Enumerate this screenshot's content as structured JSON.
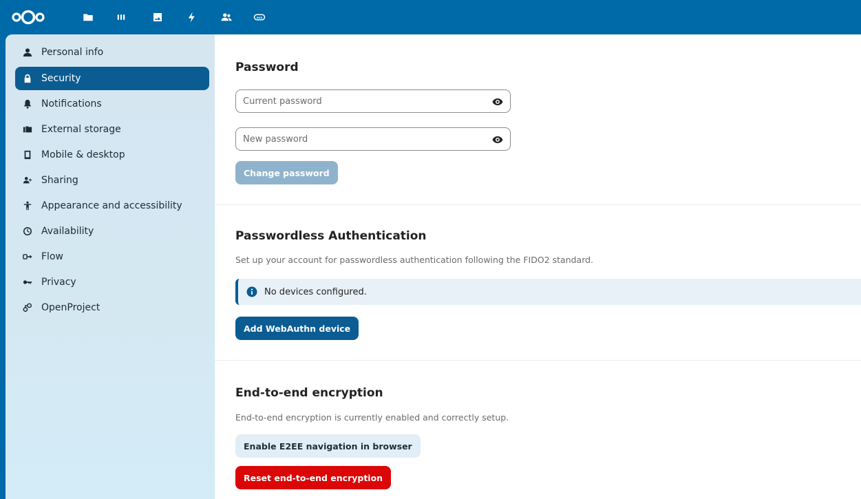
{
  "header": {
    "apps": [
      {
        "icon": "folder-icon",
        "name": "files"
      },
      {
        "icon": "deck-icon",
        "name": "deck"
      },
      {
        "icon": "photos-icon",
        "name": "photos"
      },
      {
        "icon": "activity-icon",
        "name": "activity"
      },
      {
        "icon": "contacts-icon",
        "name": "contacts"
      },
      {
        "icon": "ocs-icon",
        "name": "ocs"
      }
    ]
  },
  "sidebar": {
    "items": [
      {
        "label": "Personal info",
        "icon": "user-icon"
      },
      {
        "label": "Security",
        "icon": "lock-icon",
        "active": true
      },
      {
        "label": "Notifications",
        "icon": "bell-icon"
      },
      {
        "label": "External storage",
        "icon": "external-storage-icon"
      },
      {
        "label": "Mobile & desktop",
        "icon": "phone-icon"
      },
      {
        "label": "Sharing",
        "icon": "share-user-icon"
      },
      {
        "label": "Appearance and accessibility",
        "icon": "accessibility-icon"
      },
      {
        "label": "Availability",
        "icon": "clock-icon"
      },
      {
        "label": "Flow",
        "icon": "flow-icon"
      },
      {
        "label": "Privacy",
        "icon": "key-icon"
      },
      {
        "label": "OpenProject",
        "icon": "openproject-icon"
      }
    ]
  },
  "password": {
    "title": "Password",
    "current_placeholder": "Current password",
    "new_placeholder": "New password",
    "change_label": "Change password"
  },
  "passwordless": {
    "title": "Passwordless Authentication",
    "description": "Set up your account for passwordless authentication following the FIDO2 standard.",
    "note": "No devices configured.",
    "add_label": "Add WebAuthn device"
  },
  "e2ee": {
    "title": "End-to-end encryption",
    "description": "End-to-end encryption is currently enabled and correctly setup.",
    "enable_nav_label": "Enable E2EE navigation in browser",
    "reset_label": "Reset end-to-end encryption"
  },
  "colors": {
    "header": "#0069a8",
    "primary": "#0b5c92",
    "danger": "#db0606"
  }
}
